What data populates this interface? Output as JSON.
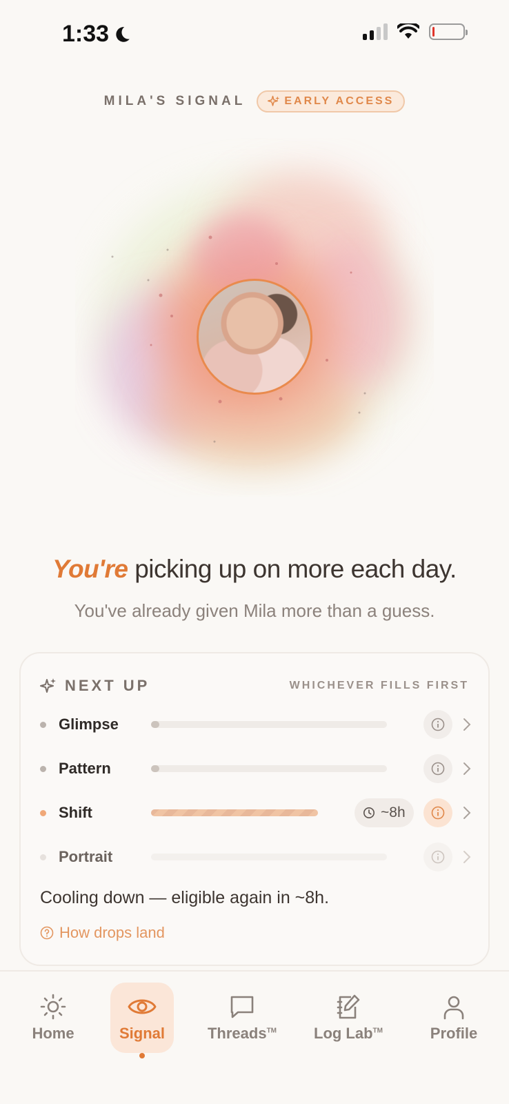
{
  "status_bar": {
    "time": "1:33"
  },
  "header": {
    "title": "MILA'S SIGNAL",
    "badge": "EARLY ACCESS"
  },
  "headline": {
    "accent": "You're",
    "rest": " picking up on more each day."
  },
  "subheadline": "You've already given Mila more than a guess.",
  "next_up": {
    "title": "NEXT UP",
    "hint": "WHICHEVER FILLS FIRST",
    "items": [
      {
        "label": "Glimpse",
        "progress": 0.02
      },
      {
        "label": "Pattern",
        "progress": 0.02
      },
      {
        "label": "Shift",
        "progress": 1.0,
        "timer": "~8h"
      },
      {
        "label": "Portrait",
        "progress": 0.0
      }
    ],
    "status": "Cooling down — eligible again in ~8h.",
    "link": "How drops land"
  },
  "tabs": [
    {
      "label": "Home",
      "icon": "sun-icon",
      "tm": ""
    },
    {
      "label": "Signal",
      "icon": "eye-icon",
      "tm": "",
      "active": true
    },
    {
      "label": "Threads",
      "icon": "chat-bubble-icon",
      "tm": "TM"
    },
    {
      "label": "Log Lab",
      "icon": "edit-notebook-icon",
      "tm": "TM"
    },
    {
      "label": "Profile",
      "icon": "person-icon",
      "tm": ""
    }
  ],
  "colors": {
    "accent": "#e07a36",
    "background": "#faf8f5"
  }
}
